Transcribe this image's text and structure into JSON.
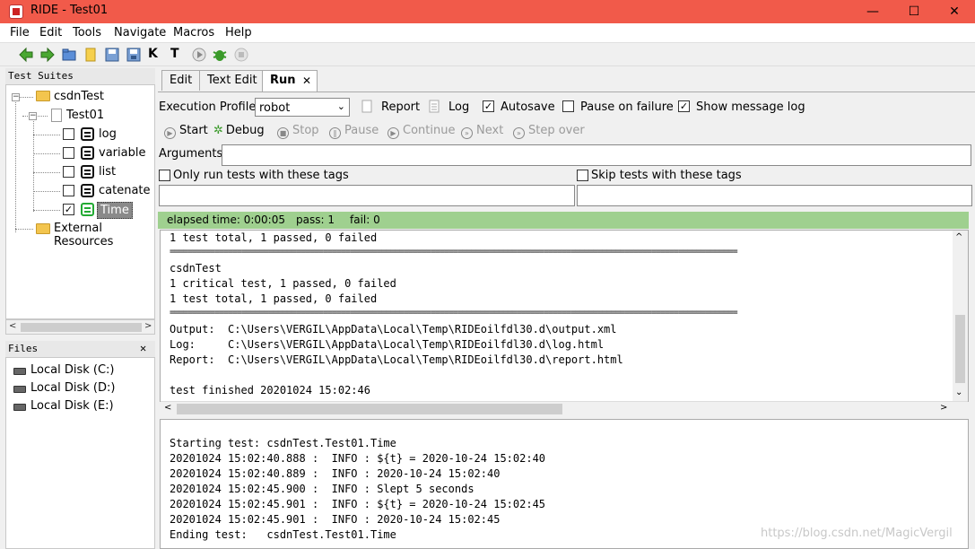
{
  "window": {
    "title": "RIDE - Test01",
    "minimize": "—",
    "maximize": "☐",
    "close": "✕"
  },
  "menu": [
    "File",
    "Edit",
    "Tools",
    "Navigate",
    "Macros",
    "Help"
  ],
  "left": {
    "suites_header": "Test Suites",
    "tree": {
      "root": "csdnTest",
      "suite": "Test01",
      "keywords": [
        "log",
        "variable",
        "list",
        "catenate",
        "Time"
      ],
      "external": "External Resources"
    },
    "files_header": "Files",
    "files_close": "✕",
    "disks": [
      "Local Disk (C:)",
      "Local Disk (D:)",
      "Local Disk (E:)"
    ]
  },
  "tabs": [
    "Edit",
    "Text Edit",
    "Run"
  ],
  "tab_close": "✕",
  "run": {
    "execution_profile_label": "Execution Profile:",
    "profile_value": "robot",
    "report": "Report",
    "log": "Log",
    "autosave": "Autosave",
    "pause_on_failure": "Pause on failure",
    "show_message_log": "Show message log",
    "buttons": {
      "start": "Start",
      "debug": "Debug",
      "stop": "Stop",
      "pause": "Pause",
      "continue": "Continue",
      "next": "Next",
      "step_over": "Step over"
    },
    "arguments_label": "Arguments:",
    "only_run_tags": "Only run tests with these tags",
    "skip_tags": "Skip tests with these tags"
  },
  "status": {
    "elapsed": "elapsed time: 0:00:05",
    "pass": "pass: 1",
    "fail": "fail: 0"
  },
  "output_lines": [
    "1 test total, 1 passed, 0 failed",
    "==============================================================================================================================",
    "csdnTest",
    "1 critical test, 1 passed, 0 failed",
    "1 test total, 1 passed, 0 failed",
    "==============================================================================================================================",
    "Output:  C:\\Users\\VERGIL\\AppData\\Local\\Temp\\RIDEoilfdl30.d\\output.xml",
    "Log:     C:\\Users\\VERGIL\\AppData\\Local\\Temp\\RIDEoilfdl30.d\\log.html",
    "Report:  C:\\Users\\VERGIL\\AppData\\Local\\Temp\\RIDEoilfdl30.d\\report.html",
    "",
    "test finished 20201024 15:02:46"
  ],
  "log_lines": [
    "Starting test: csdnTest.Test01.Time",
    "20201024 15:02:40.888 :  INFO : ${t} = 2020-10-24 15:02:40",
    "20201024 15:02:40.889 :  INFO : 2020-10-24 15:02:40",
    "20201024 15:02:45.900 :  INFO : Slept 5 seconds",
    "20201024 15:02:45.901 :  INFO : ${t} = 2020-10-24 15:02:45",
    "20201024 15:02:45.901 :  INFO : 2020-10-24 15:02:45",
    "Ending test:   csdnTest.Test01.Time"
  ],
  "watermark": "https://blog.csdn.net/MagicVergil"
}
